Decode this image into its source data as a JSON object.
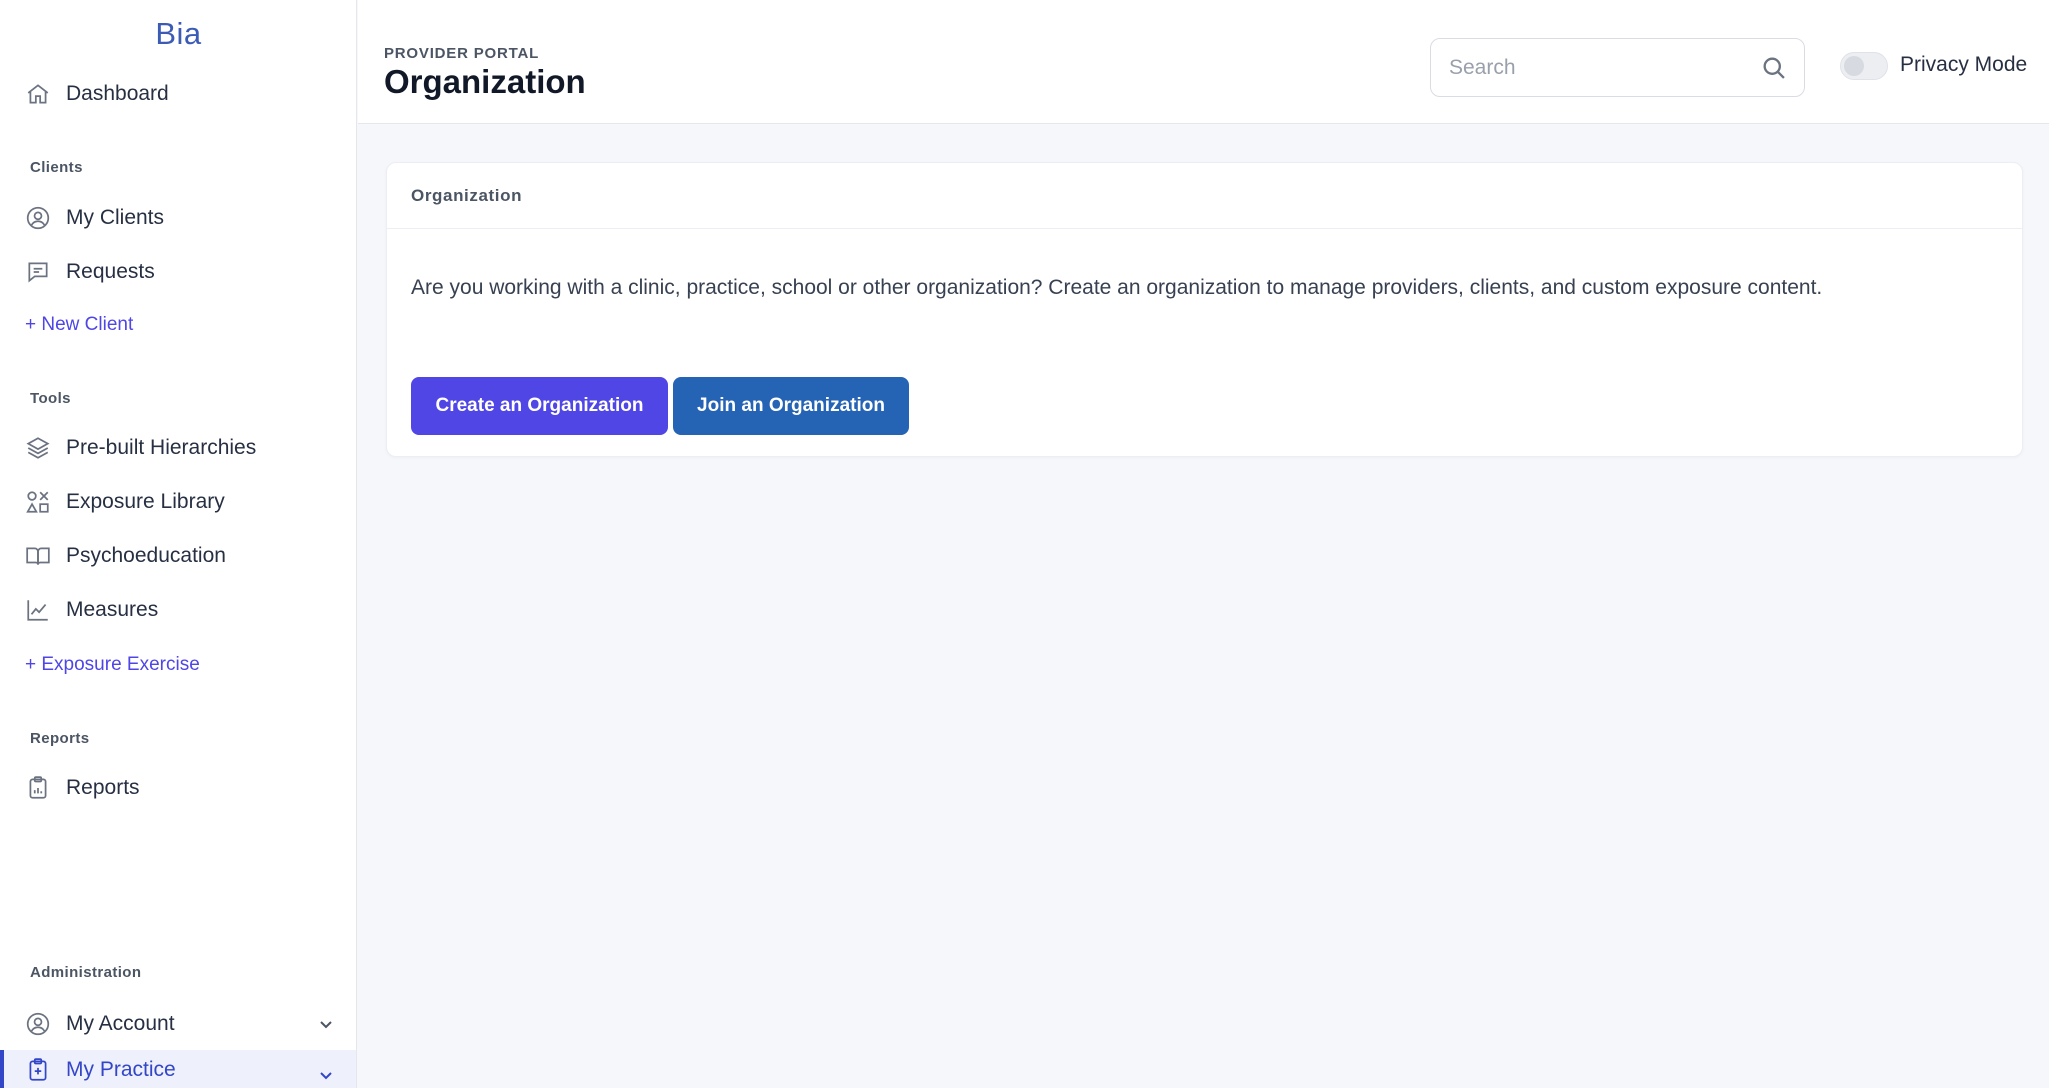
{
  "brand": "Bia",
  "sidebar": {
    "dashboard": "Dashboard",
    "clients_title": "Clients",
    "my_clients": "My Clients",
    "requests": "Requests",
    "new_client": "+ New Client",
    "tools_title": "Tools",
    "prebuilt": "Pre-built Hierarchies",
    "exposure_library": "Exposure Library",
    "psychoeducation": "Psychoeducation",
    "measures": "Measures",
    "exposure_exercise": "+ Exposure Exercise",
    "reports_title": "Reports",
    "reports": "Reports",
    "admin_title": "Administration",
    "my_account": "My Account",
    "my_practice": "My Practice"
  },
  "header": {
    "eyebrow": "PROVIDER PORTAL",
    "title": "Organization",
    "search_placeholder": "Search",
    "privacy_label": "Privacy Mode",
    "privacy_on": false
  },
  "card": {
    "title": "Organization",
    "text": "Are you working with a clinic, practice, school or other organization? Create an organization to manage providers, clients, and custom exposure content.",
    "create_label": "Create an Organization",
    "join_label": "Join an Organization"
  },
  "colors": {
    "accent": "#4f46e5",
    "secondary_button": "#2563b5",
    "brand": "#3b5bb5"
  }
}
